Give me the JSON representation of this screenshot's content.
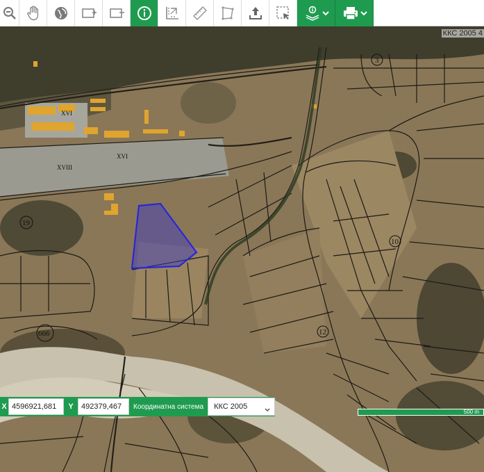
{
  "toolbar": {
    "buttons": [
      {
        "icon": "zoom-out-icon",
        "active": false
      },
      {
        "icon": "pan-hand-icon",
        "active": false
      },
      {
        "icon": "globe-icon",
        "active": false
      },
      {
        "icon": "zoom-in-box-icon",
        "active": false
      },
      {
        "icon": "zoom-out-box-icon",
        "active": false
      },
      {
        "icon": "info-icon",
        "active": true
      },
      {
        "icon": "measure-area-icon",
        "active": false
      },
      {
        "icon": "ruler-icon",
        "active": false
      },
      {
        "icon": "polygon-measure-icon",
        "active": false
      },
      {
        "icon": "upload-icon",
        "active": false
      },
      {
        "icon": "select-box-icon",
        "active": false
      },
      {
        "icon": "layers-info-icon",
        "active": false,
        "dropdown": true
      },
      {
        "icon": "print-icon",
        "active": false,
        "dropdown": true
      }
    ],
    "accent": "#1f9b4f"
  },
  "map": {
    "projection_label": "ККС 2005 4",
    "selected_parcel_color": "#3a37c8",
    "labels": [
      "3",
      "19",
      "10",
      "666",
      "12",
      "XVIII",
      "XVI",
      "XVI"
    ]
  },
  "coords": {
    "x_tag": "X",
    "x_value": "4596921,681",
    "y_tag": "Y",
    "y_value": "492379,467",
    "system_label": "Координатна система",
    "system_value": "ККС 2005"
  },
  "scale": {
    "label": "500 m"
  }
}
